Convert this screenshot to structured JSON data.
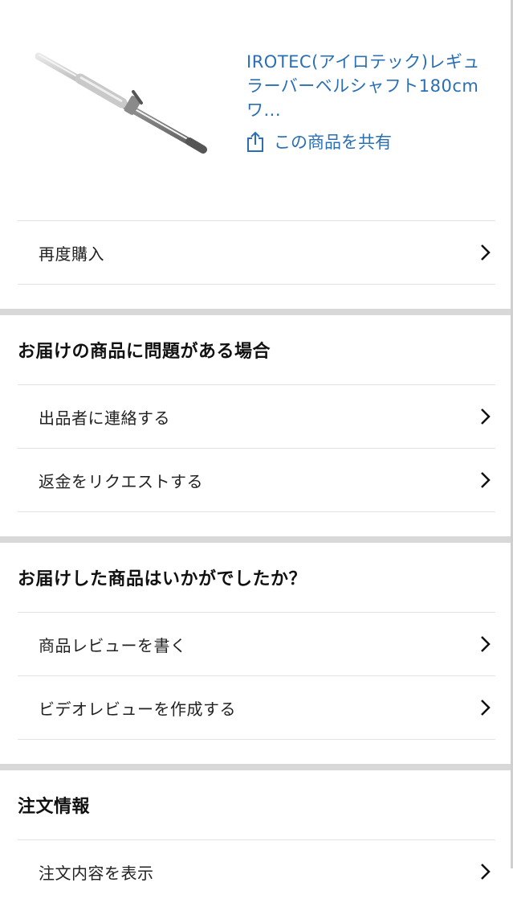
{
  "product": {
    "title": "IROTEC(アイロテック)レギュラーバーベルシャフト180cmワ...",
    "share_label": "この商品を共有"
  },
  "buy_again": {
    "label": "再度購入"
  },
  "problem_section": {
    "title": "お届けの商品に問題がある場合",
    "items": [
      {
        "label": "出品者に連絡する"
      },
      {
        "label": "返金をリクエストする"
      }
    ]
  },
  "review_section": {
    "title": "お届けした商品はいかがでしたか？",
    "items": [
      {
        "label": "商品レビューを書く"
      },
      {
        "label": "ビデオレビューを作成する"
      }
    ]
  },
  "order_section": {
    "title": "注文情報",
    "items": [
      {
        "label": "注文内容を表示"
      }
    ]
  },
  "colors": {
    "link": "#2a6fb4",
    "divider": "#d8d8d8"
  }
}
